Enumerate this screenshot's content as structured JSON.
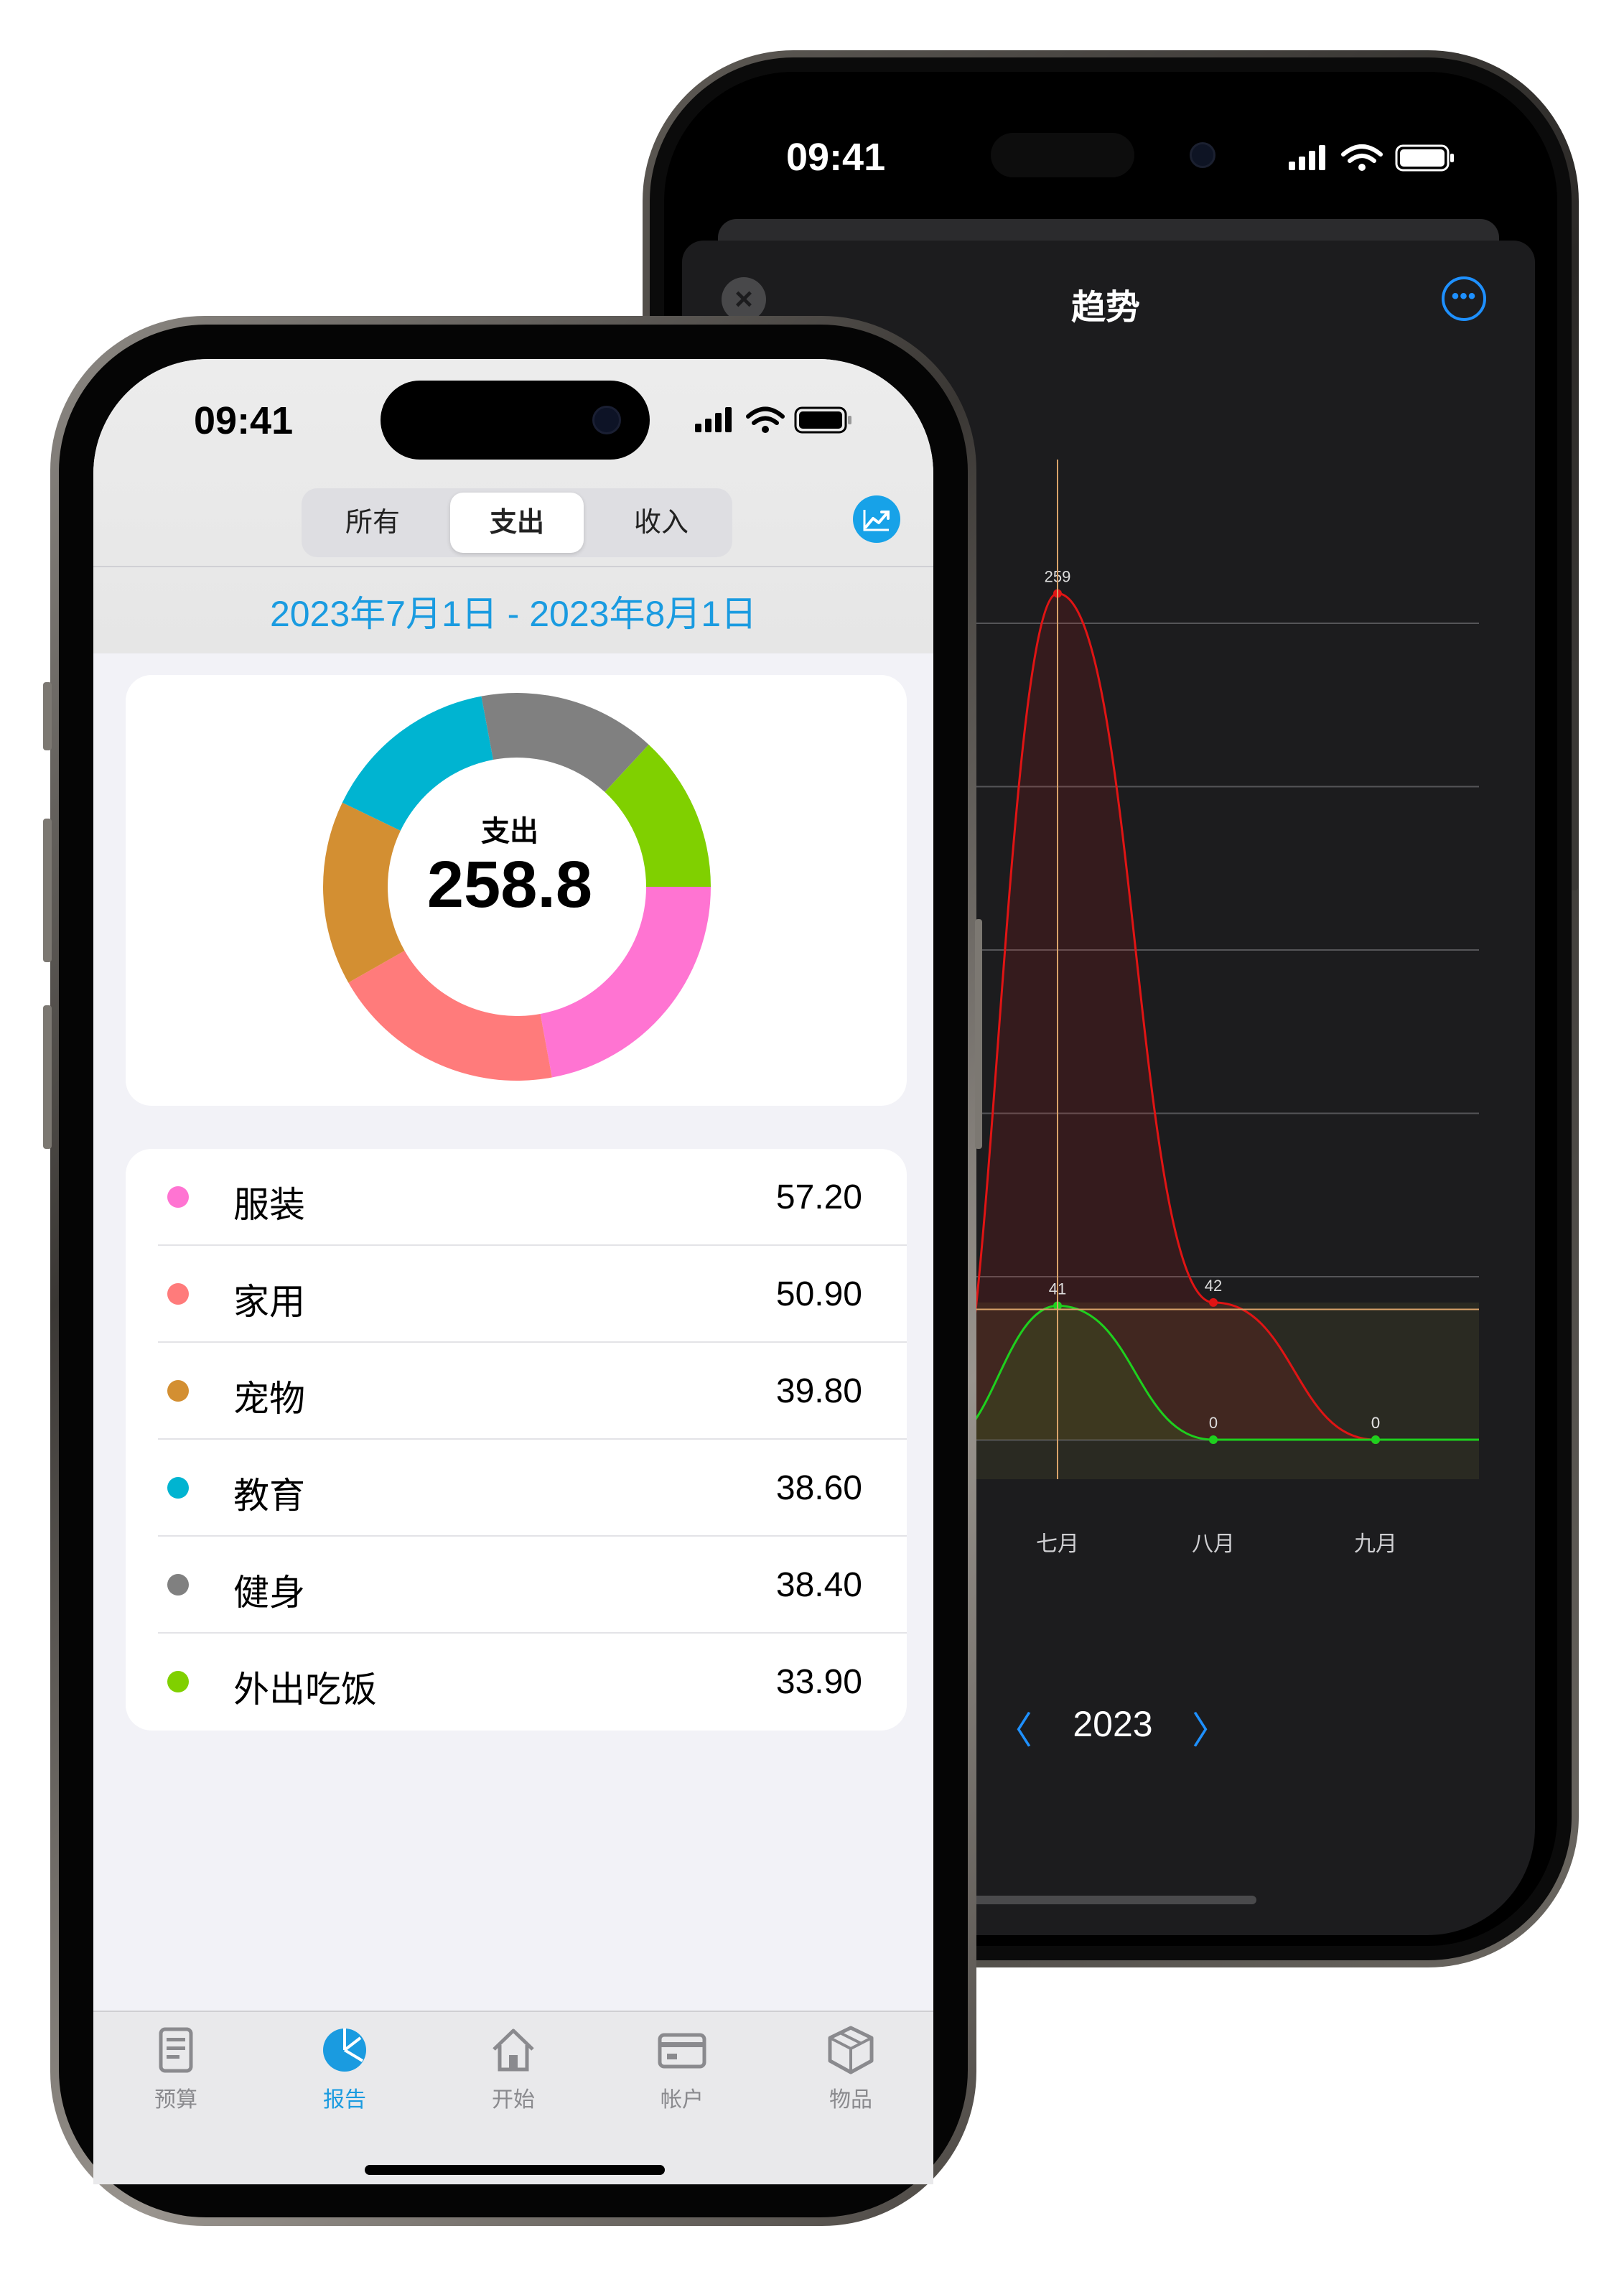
{
  "back_phone": {
    "status_time": "09:41",
    "title": "趋势",
    "year": "2023",
    "prev_icon": "chevron-left-icon",
    "next_icon": "chevron-right-icon"
  },
  "front_phone": {
    "status_time": "09:41",
    "segments": [
      "所有",
      "支出",
      "收入"
    ],
    "active_segment": "支出",
    "date_range": "2023年7月1日 - 2023年8月1日",
    "donut": {
      "label": "支出",
      "value": "258.8"
    },
    "categories": [
      {
        "name": "服装",
        "amount": "57.20",
        "color": "#ff74d2"
      },
      {
        "name": "家用",
        "amount": "50.90",
        "color": "#ff7b7b"
      },
      {
        "name": "宠物",
        "amount": "39.80",
        "color": "#d38f32"
      },
      {
        "name": "教育",
        "amount": "38.60",
        "color": "#00b4d1"
      },
      {
        "name": "健身",
        "amount": "38.40",
        "color": "#808080"
      },
      {
        "name": "外出吃饭",
        "amount": "33.90",
        "color": "#80d000"
      }
    ],
    "tabs": [
      {
        "label": "预算",
        "icon": "budget-icon",
        "active": false
      },
      {
        "label": "报告",
        "icon": "report-pie-icon",
        "active": true
      },
      {
        "label": "开始",
        "icon": "home-icon",
        "active": false
      },
      {
        "label": "帐户",
        "icon": "card-icon",
        "active": false
      },
      {
        "label": "物品",
        "icon": "box-icon",
        "active": false
      }
    ]
  },
  "chart_data": [
    {
      "type": "pie",
      "title": "支出",
      "categories": [
        "服装",
        "家用",
        "宠物",
        "教育",
        "健身",
        "外出吃饭"
      ],
      "values": [
        57.2,
        50.9,
        39.8,
        38.6,
        38.4,
        33.9
      ],
      "colors": [
        "#ff74d2",
        "#ff7b7b",
        "#d38f32",
        "#00b4d1",
        "#808080",
        "#80d000"
      ]
    },
    {
      "type": "line",
      "categories": [
        "七月",
        "八月",
        "九月"
      ],
      "series": [
        {
          "values": [
            259,
            42,
            0
          ],
          "color": "#e01414"
        },
        {
          "values": [
            41,
            0,
            0
          ],
          "color": "#1ed01e"
        }
      ],
      "ylim": [
        0,
        300
      ],
      "grid": true
    }
  ]
}
